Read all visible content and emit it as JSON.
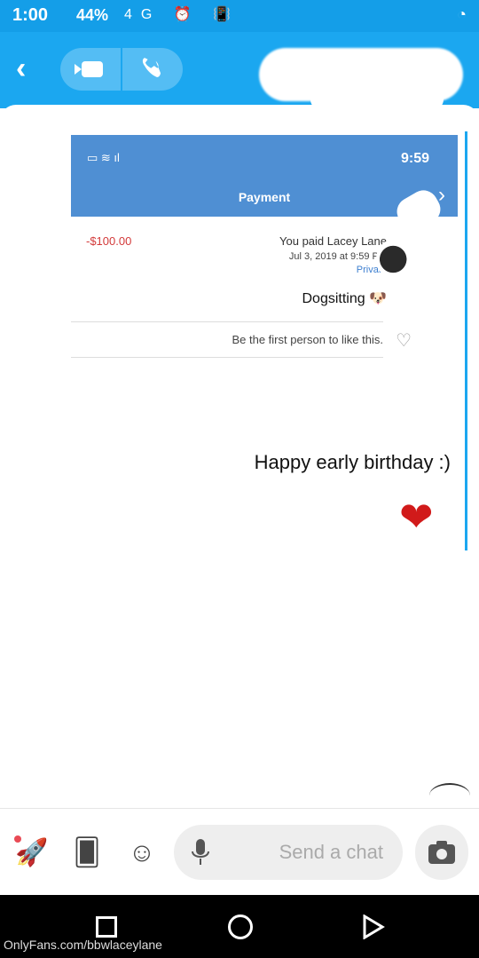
{
  "status_bar": {
    "time": "1:00",
    "battery": "44%",
    "network": "4G"
  },
  "header": {
    "back_icon": "chevron-left-icon",
    "video_icon": "video-camera-icon",
    "phone_icon": "phone-icon"
  },
  "shared_screenshot": {
    "time": "9:59",
    "title": "Payment",
    "payer_line": "You paid Lacey Lane",
    "date": "Jul 3, 2019 at 9:59 PM",
    "privacy": "Private",
    "amount": "-$100.00",
    "note": "Dogsitting 🐶",
    "like_text": "Be the first person to like this."
  },
  "message": {
    "text": "Happy early birthday :)",
    "heart": "❤"
  },
  "composer": {
    "placeholder": "Send a chat",
    "icons": [
      "rocket-icon",
      "cards-icon",
      "emoji-icon",
      "mic-icon",
      "camera-icon"
    ]
  },
  "watermark": "OnlyFans.com/bbwlaceylane",
  "colors": {
    "brand": "#1ba7f0",
    "amount_negative": "#d33a3a",
    "heart": "#d11a1a"
  }
}
